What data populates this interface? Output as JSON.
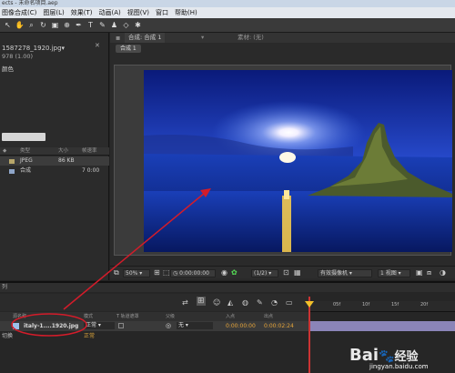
{
  "titlebar": {
    "text": "ects - 未命名项目.aep"
  },
  "menu": [
    "图像合成(C)",
    "图层(L)",
    "效果(T)",
    "动画(A)",
    "视图(V)",
    "窗口",
    "帮助(H)"
  ],
  "project": {
    "filename": "1587278_1920.jpg▾",
    "info": "978 (1.00)",
    "color_label": "颜色",
    "columns": {
      "type": "类型",
      "size": "大小",
      "fps": "帧速率"
    },
    "items": [
      {
        "type": "JPEG",
        "size": "86 KB",
        "fps": ""
      },
      {
        "type": "合成",
        "size": "",
        "fps": "7 0:00"
      }
    ]
  },
  "viewer": {
    "tab": "合成: 合成 1",
    "tab2": "素材: (无)",
    "subtab": "合成 1",
    "zoom": "50%",
    "timecode": "0:00:00:00",
    "resolution": "(1/2)",
    "camera": "有效摄像机",
    "views": "1 视图"
  },
  "timeline": {
    "header": "列",
    "cols": {
      "source": "源名称",
      "mode": "模式",
      "trk": "T  轨道遮罩",
      "parent": "父级",
      "in": "入点",
      "out": "出点"
    },
    "layer": {
      "name": "italy-1....1920.jpg",
      "mode": "正常",
      "parent": "无",
      "in": "0:00:00:00",
      "out": "0:00:02:24"
    },
    "switch_label": "切换",
    "ticks": [
      "00f",
      "05f",
      "10f",
      "15f",
      "20f"
    ]
  },
  "watermark": {
    "brand": "Bai",
    "mid": "经验",
    "url": "jingyan.baidu.com"
  }
}
